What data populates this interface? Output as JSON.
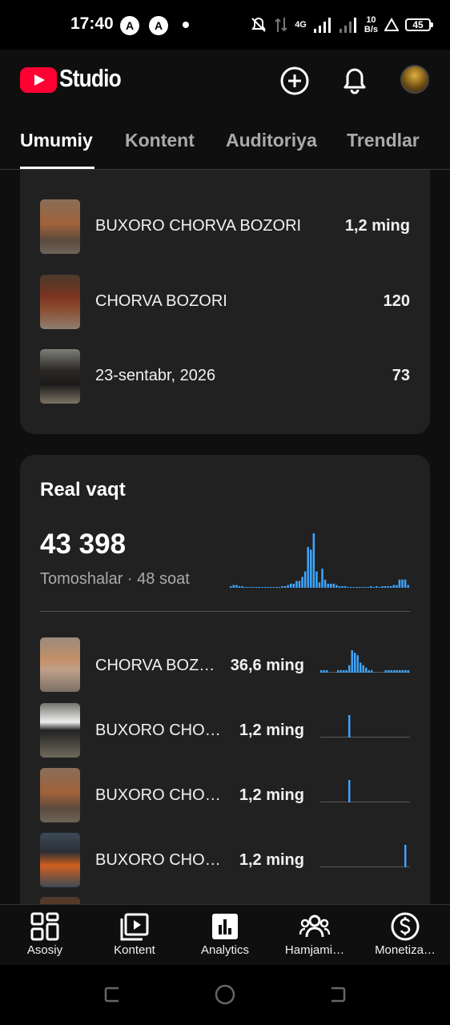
{
  "status_bar": {
    "time": "17:40",
    "app_icons": [
      "A",
      "A"
    ],
    "network_type": "4G",
    "network_speed": "10",
    "network_speed_unit": "B/s",
    "battery": "45"
  },
  "header": {
    "logo_text": "Studio",
    "icons": [
      "add-circle-icon",
      "bell-icon",
      "avatar"
    ]
  },
  "tabs": [
    {
      "label": "Umumiy",
      "active": true
    },
    {
      "label": "Kontent",
      "active": false
    },
    {
      "label": "Auditoriya",
      "active": false
    },
    {
      "label": "Trendlar",
      "active": false
    }
  ],
  "top_content": {
    "rows": [
      {
        "title": "BUXORO CHORVA BOZORI",
        "value": "1,2 ming"
      },
      {
        "title": "CHORVA BOZORI",
        "value": "120"
      },
      {
        "title": "23-sentabr, 2026",
        "value": "73"
      }
    ]
  },
  "realtime": {
    "title": "Real vaqt",
    "count": "43 398",
    "subtitle": "Tomoshalar · 48 soat",
    "accent_color": "#3ea6ff",
    "chart_data": {
      "type": "bar",
      "series_name": "",
      "values": [
        1,
        2,
        2,
        1,
        1,
        0,
        0,
        0,
        0,
        0,
        0,
        0,
        0,
        0,
        0,
        0,
        0,
        0,
        1,
        1,
        2,
        3,
        3,
        5,
        5,
        8,
        12,
        30,
        28,
        40,
        12,
        4,
        14,
        6,
        3,
        3,
        3,
        2,
        1,
        1,
        1,
        0,
        0,
        0,
        0,
        0,
        0,
        0,
        0,
        1,
        0,
        1,
        0,
        1,
        1,
        1,
        1,
        2,
        2,
        6,
        6,
        6,
        2
      ]
    },
    "videos": [
      {
        "title": "CHORVA BOZORI",
        "value": "36,6 ming",
        "spark": [
          1,
          1,
          1,
          0,
          0,
          0,
          1,
          1,
          1,
          1,
          3,
          9,
          8,
          7,
          4,
          3,
          2,
          1,
          1,
          0,
          0,
          0,
          0,
          1,
          1,
          1,
          1,
          1,
          1,
          1,
          1,
          1
        ]
      },
      {
        "title": "BUXORO CHORVA BOZORI",
        "value": "1,2 ming",
        "spark": [
          0,
          0,
          0,
          0,
          0,
          0,
          0,
          0,
          0,
          0,
          1,
          0,
          0,
          0,
          0,
          0,
          0,
          0,
          0,
          0,
          0,
          0,
          0,
          0,
          0,
          0,
          0,
          0,
          0,
          0,
          0,
          0
        ]
      },
      {
        "title": "BUXORO CHORVA BOZORI",
        "value": "1,2 ming",
        "spark": [
          0,
          0,
          0,
          0,
          0,
          0,
          0,
          0,
          0,
          0,
          1,
          0,
          0,
          0,
          0,
          0,
          0,
          0,
          0,
          0,
          0,
          0,
          0,
          0,
          0,
          0,
          0,
          0,
          0,
          0,
          0,
          0
        ]
      },
      {
        "title": "BUXORO CHORVA BOZORI",
        "value": "1,2 ming",
        "spark": [
          0,
          0,
          0,
          0,
          0,
          0,
          0,
          0,
          0,
          0,
          0,
          0,
          0,
          0,
          0,
          0,
          0,
          0,
          0,
          0,
          0,
          0,
          0,
          0,
          0,
          0,
          0,
          0,
          0,
          0,
          1,
          0
        ]
      }
    ]
  },
  "bottom_nav": [
    {
      "label": "Asosiy",
      "icon": "dashboard-icon"
    },
    {
      "label": "Kontent",
      "icon": "content-icon"
    },
    {
      "label": "Analytics",
      "icon": "analytics-icon"
    },
    {
      "label": "Hamjami…",
      "icon": "community-icon"
    },
    {
      "label": "Monetiza…",
      "icon": "dollar-icon"
    }
  ]
}
